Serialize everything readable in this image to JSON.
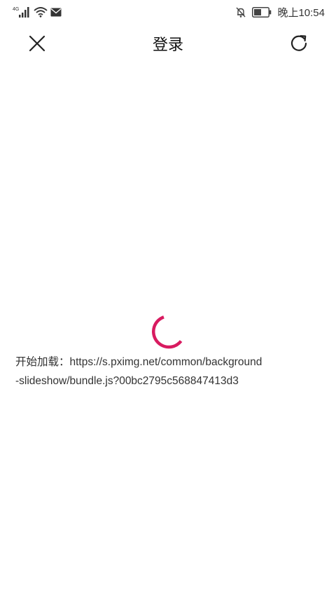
{
  "status_bar": {
    "network_label": "4G",
    "time": "晚上10:54",
    "icons": [
      "signal-icon",
      "wifi-icon",
      "mail-icon",
      "notifications-off-icon",
      "battery-icon"
    ]
  },
  "toolbar": {
    "title": "登录",
    "close_icon": "close-icon",
    "refresh_icon": "refresh-icon"
  },
  "loading": {
    "spinner_color": "#d81b60",
    "line1": "开始加载：https://s.pximg.net/common/background",
    "line2": "-slideshow/bundle.js?00bc2795c568847413d3"
  }
}
